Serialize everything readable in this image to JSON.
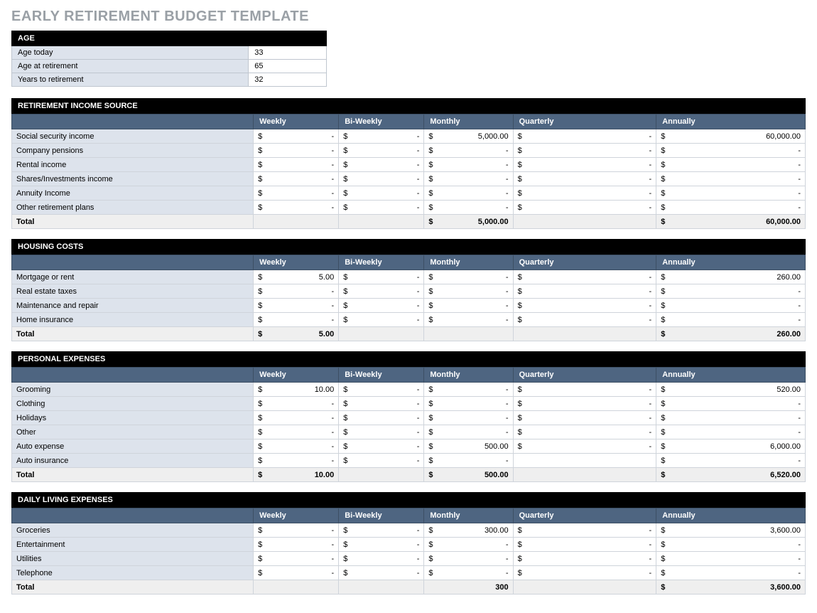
{
  "title": "EARLY RETIREMENT BUDGET TEMPLATE",
  "currency": "$",
  "dash": "-",
  "age": {
    "header": "AGE",
    "rows": [
      {
        "label": "Age today",
        "value": "33"
      },
      {
        "label": "Age at retirement",
        "value": "65"
      },
      {
        "label": "Years to retirement",
        "value": "32"
      }
    ]
  },
  "columns": [
    "Weekly",
    "Bi-Weekly",
    "Monthly",
    "Quarterly",
    "Annually"
  ],
  "sections": [
    {
      "title": "RETIREMENT INCOME SOURCE",
      "rows": [
        {
          "label": "Social security income",
          "weekly": "-",
          "biweekly": "-",
          "monthly": "5,000.00",
          "quarterly": "-",
          "annually": "60,000.00"
        },
        {
          "label": "Company pensions",
          "weekly": "-",
          "biweekly": "-",
          "monthly": "-",
          "quarterly": "-",
          "annually": "-"
        },
        {
          "label": "Rental income",
          "weekly": "-",
          "biweekly": "-",
          "monthly": "-",
          "quarterly": "-",
          "annually": "-"
        },
        {
          "label": "Shares/Investments income",
          "weekly": "-",
          "biweekly": "-",
          "monthly": "-",
          "quarterly": "-",
          "annually": "-"
        },
        {
          "label": "Annuity Income",
          "weekly": "-",
          "biweekly": "-",
          "monthly": "-",
          "quarterly": "-",
          "annually": "-"
        },
        {
          "label": "Other retirement plans",
          "weekly": "-",
          "biweekly": "-",
          "monthly": "-",
          "quarterly": "-",
          "annually": "-"
        }
      ],
      "total": {
        "label": "Total",
        "weekly": "",
        "biweekly": "",
        "monthly": "5,000.00",
        "quarterly": "",
        "annually": "60,000.00",
        "show_cur": {
          "weekly": false,
          "biweekly": false,
          "monthly": true,
          "quarterly": false,
          "annually": true
        }
      }
    },
    {
      "title": "HOUSING COSTS",
      "rows": [
        {
          "label": "Mortgage or rent",
          "weekly": "5.00",
          "biweekly": "-",
          "monthly": "-",
          "quarterly": "-",
          "annually": "260.00"
        },
        {
          "label": "Real estate taxes",
          "weekly": "-",
          "biweekly": "-",
          "monthly": "-",
          "quarterly": "-",
          "annually": "-"
        },
        {
          "label": "Maintenance and repair",
          "weekly": "-",
          "biweekly": "-",
          "monthly": "-",
          "quarterly": "-",
          "annually": "-"
        },
        {
          "label": "Home insurance",
          "weekly": "-",
          "biweekly": "-",
          "monthly": "-",
          "quarterly": "-",
          "annually": "-"
        }
      ],
      "total": {
        "label": "Total",
        "weekly": "5.00",
        "biweekly": "",
        "monthly": "",
        "quarterly": "",
        "annually": "260.00",
        "show_cur": {
          "weekly": true,
          "biweekly": false,
          "monthly": false,
          "quarterly": false,
          "annually": true
        }
      }
    },
    {
      "title": "PERSONAL EXPENSES",
      "rows": [
        {
          "label": "Grooming",
          "weekly": "10.00",
          "biweekly": "-",
          "monthly": "-",
          "quarterly": "-",
          "annually": "520.00"
        },
        {
          "label": "Clothing",
          "weekly": "-",
          "biweekly": "-",
          "monthly": "-",
          "quarterly": "-",
          "annually": "-"
        },
        {
          "label": "Holidays",
          "weekly": "-",
          "biweekly": "-",
          "monthly": "-",
          "quarterly": "-",
          "annually": "-"
        },
        {
          "label": "Other",
          "weekly": "-",
          "biweekly": "-",
          "monthly": "-",
          "quarterly": "-",
          "annually": "-"
        },
        {
          "label": "Auto expense",
          "weekly": "-",
          "biweekly": "-",
          "monthly": "500.00",
          "quarterly": "-",
          "annually": "6,000.00"
        },
        {
          "label": "Auto insurance",
          "weekly": "-",
          "biweekly": "-",
          "monthly": "-",
          "quarterly": "",
          "annually": "-",
          "suppress_quarterly_cur": true
        }
      ],
      "total": {
        "label": "Total",
        "weekly": "10.00",
        "biweekly": "",
        "monthly": "500.00",
        "quarterly": "",
        "annually": "6,520.00",
        "show_cur": {
          "weekly": true,
          "biweekly": false,
          "monthly": true,
          "quarterly": false,
          "annually": true
        }
      }
    },
    {
      "title": "DAILY LIVING EXPENSES",
      "rows": [
        {
          "label": "Groceries",
          "weekly": "-",
          "biweekly": "-",
          "monthly": "300.00",
          "quarterly": "-",
          "annually": "3,600.00"
        },
        {
          "label": "Entertainment",
          "weekly": "-",
          "biweekly": "-",
          "monthly": "-",
          "quarterly": "-",
          "annually": "-"
        },
        {
          "label": "Utilities",
          "weekly": "-",
          "biweekly": "-",
          "monthly": "-",
          "quarterly": "-",
          "annually": "-"
        },
        {
          "label": "Telephone",
          "weekly": "-",
          "biweekly": "-",
          "monthly": "-",
          "quarterly": "-",
          "annually": "-"
        }
      ],
      "total": {
        "label": "Total",
        "weekly": "",
        "biweekly": "",
        "monthly": "300",
        "quarterly": "",
        "annually": "3,600.00",
        "show_cur": {
          "weekly": false,
          "biweekly": false,
          "monthly": false,
          "quarterly": false,
          "annually": true
        }
      }
    }
  ]
}
